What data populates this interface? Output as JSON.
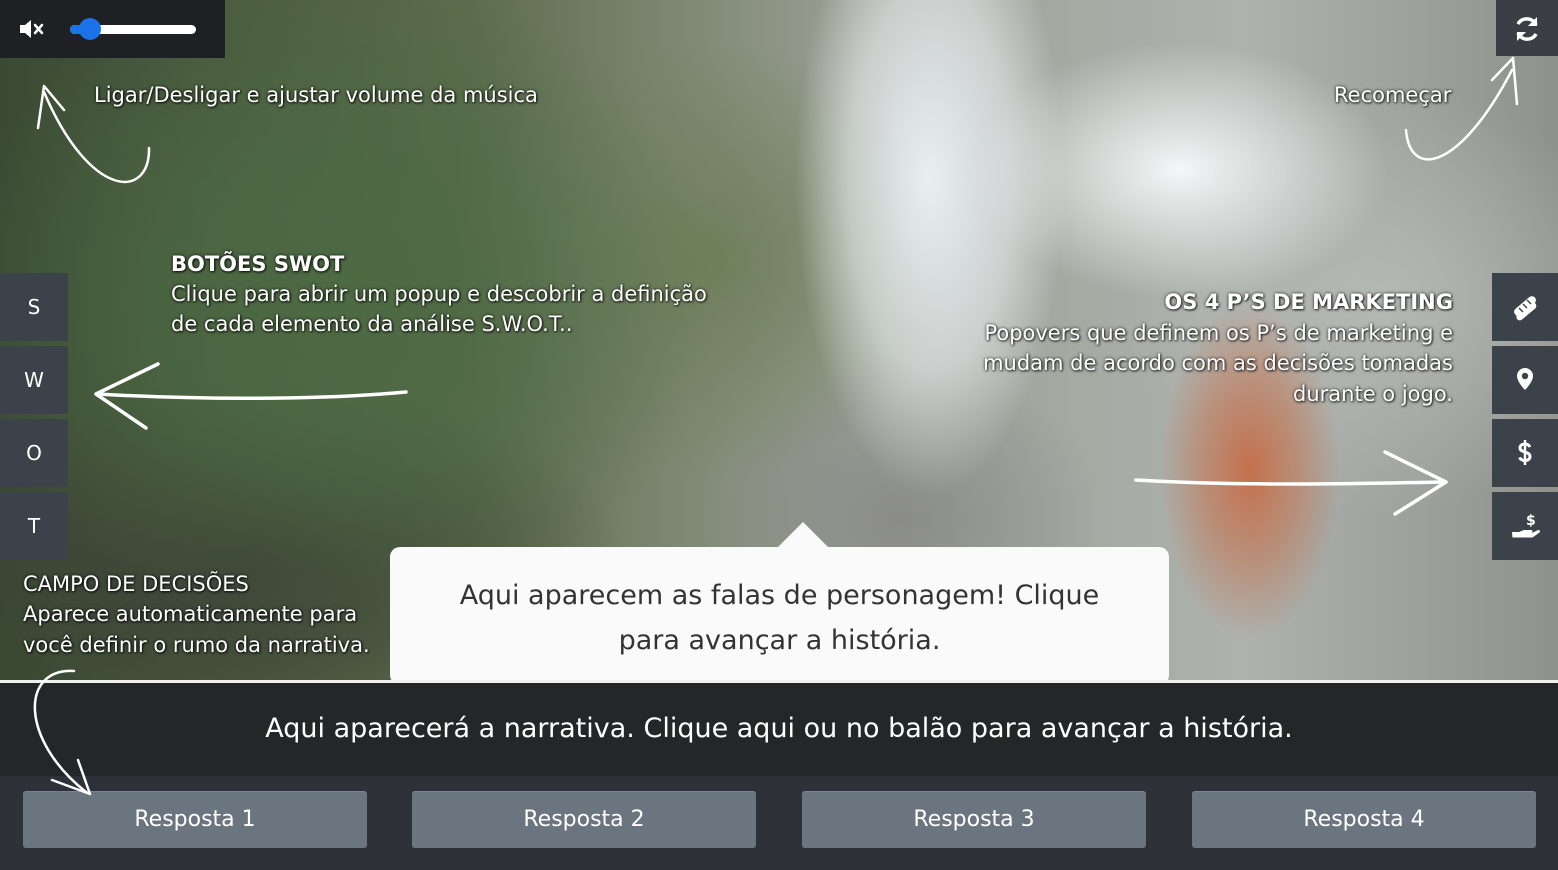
{
  "audio": {
    "volume_percent": 16,
    "mute_icon": "volume-mute-icon"
  },
  "restart": {
    "icon": "refresh-icon"
  },
  "annotations": {
    "volume": "Ligar/Desligar e ajustar volume da música",
    "restart": "Recomeçar",
    "swot_title": "BOTÕES SWOT",
    "swot_line1": "Clique para abrir um popup e descobrir a definição",
    "swot_line2": "de cada elemento da análise S.W.O.T..",
    "ps_title": "OS 4 P’S DE MARKETING",
    "ps_line1": "Popovers que definem os P’s de marketing e",
    "ps_line2": "mudam de acordo com as decisões tomadas",
    "ps_line3": "durante o jogo.",
    "decisions_title": "CAMPO DE DECISÕES",
    "decisions_line1": "Aparece automaticamente para",
    "decisions_line2": "você definir o rumo da narrativa."
  },
  "swot_buttons": [
    "S",
    "W",
    "O",
    "T"
  ],
  "marketing_ps": [
    {
      "icon": "product-icon"
    },
    {
      "icon": "place-marker-icon"
    },
    {
      "icon": "dollar-price-icon"
    },
    {
      "icon": "hand-promotion-icon"
    }
  ],
  "balloon": {
    "line1": "Aqui aparecem as falas de personagem! Clique",
    "line2": "para avançar a história."
  },
  "narrative": "Aqui aparecerá a narrativa. Clique aqui ou no balão para avançar a história.",
  "answers": [
    "Resposta 1",
    "Resposta 2",
    "Resposta 3",
    "Resposta 4"
  ]
}
